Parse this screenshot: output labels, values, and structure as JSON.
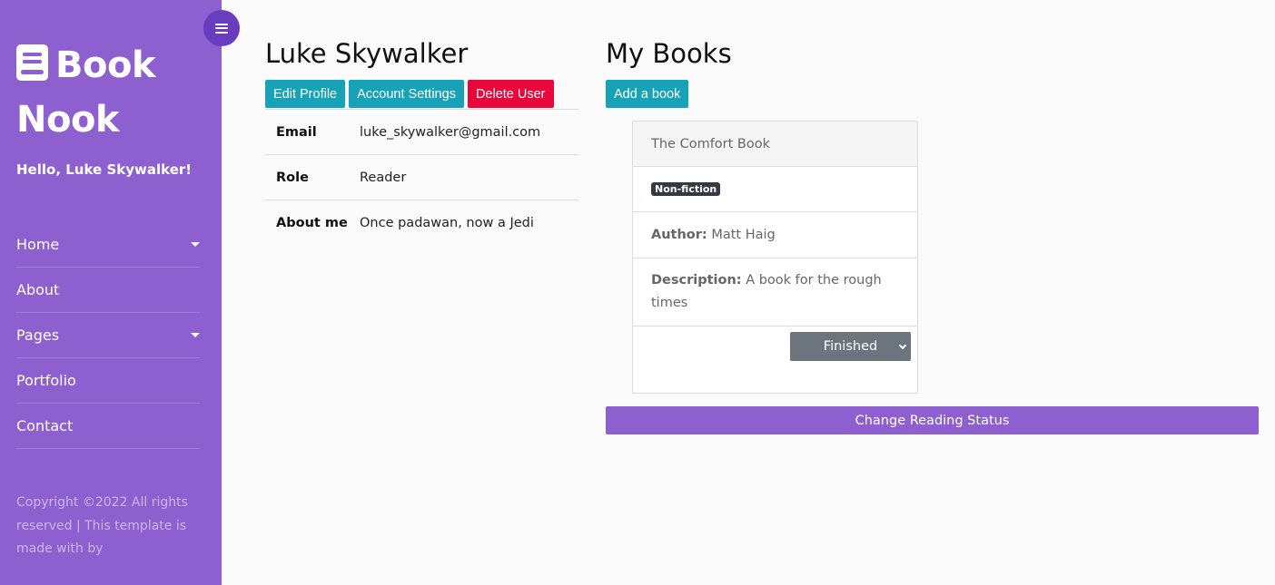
{
  "sidebar": {
    "logo_line1": "Book",
    "logo_line2": "Nook",
    "greeting": "Hello, Luke Skywalker!",
    "nav": [
      {
        "label": "Home",
        "has_dropdown": true
      },
      {
        "label": "About",
        "has_dropdown": false
      },
      {
        "label": "Pages",
        "has_dropdown": true
      },
      {
        "label": "Portfolio",
        "has_dropdown": false
      },
      {
        "label": "Contact",
        "has_dropdown": false
      }
    ],
    "footer": "Copyright ©2022 All rights reserved | This template is made with by",
    "toggle_icon": "menu-icon",
    "background_color": "#8d5fcf"
  },
  "profile": {
    "name": "Luke Skywalker",
    "buttons": {
      "edit": "Edit Profile",
      "settings": "Account Settings",
      "delete": "Delete User"
    },
    "fields": [
      {
        "label": "Email",
        "value": "luke_skywalker@gmail.com"
      },
      {
        "label": "Role",
        "value": "Reader"
      },
      {
        "label": "About me",
        "value": "Once padawan, now a Jedi"
      }
    ]
  },
  "books": {
    "title": "My Books",
    "add_button": "Add a book",
    "items": [
      {
        "title": "The Comfort Book",
        "genre": "Non-fiction",
        "author_label": "Author:",
        "author": "Matt Haig",
        "description_label": "Description:",
        "description": "A book for the rough times",
        "status": "Finished"
      }
    ],
    "change_status_button": "Change Reading Status"
  },
  "colors": {
    "accent": "#8d5fcf",
    "info": "#17a2b8",
    "danger": "#e8063a",
    "secondary": "#6c757d"
  }
}
